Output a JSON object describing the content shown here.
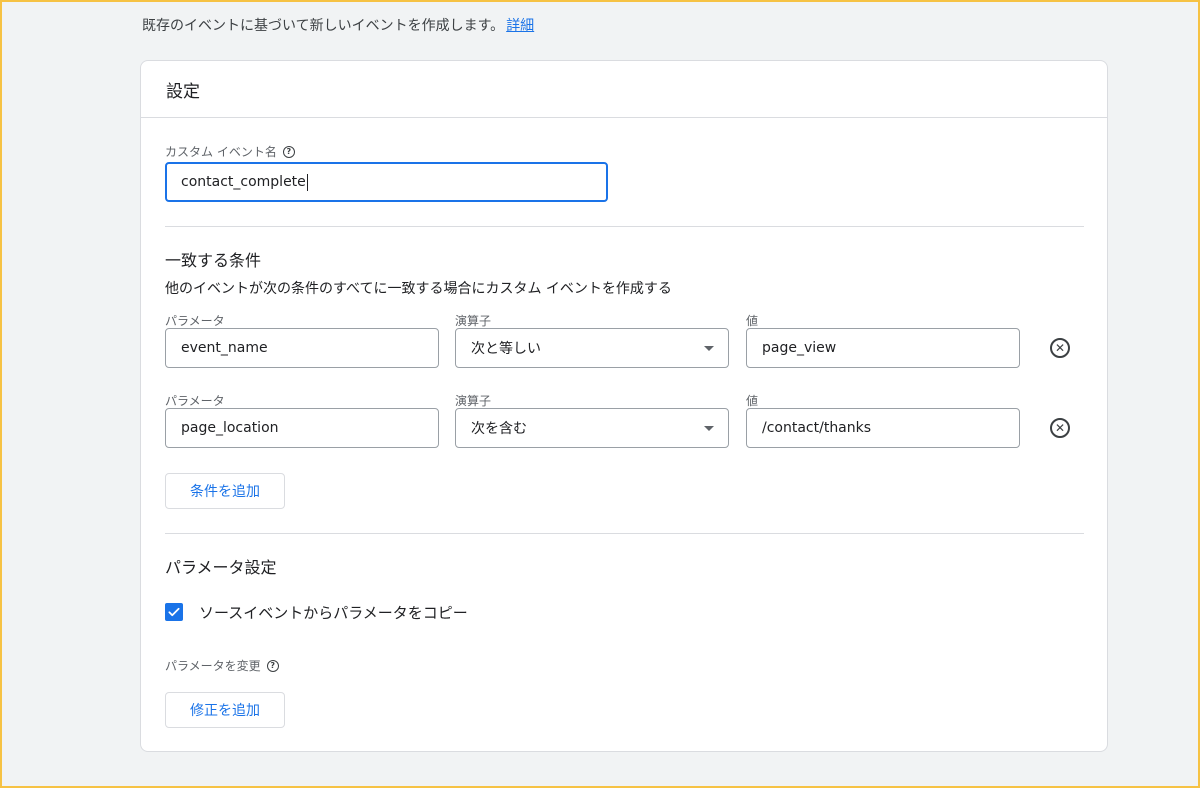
{
  "intro": {
    "text": "既存のイベントに基づいて新しいイベントを作成します。",
    "link": "詳細"
  },
  "card": {
    "title": "設定",
    "custom_event": {
      "label": "カスタム イベント名",
      "value": "contact_complete"
    },
    "conditions": {
      "title": "一致する条件",
      "description": "他のイベントが次の条件のすべてに一致する場合にカスタム イベントを作成する",
      "rows": [
        {
          "parameter_label": "パラメータ",
          "parameter_value": "event_name",
          "operator_label": "演算子",
          "operator_value": "次と等しい",
          "value_label": "値",
          "value_value": "page_view"
        },
        {
          "parameter_label": "パラメータ",
          "parameter_value": "page_location",
          "operator_label": "演算子",
          "operator_value": "次を含む",
          "value_label": "値",
          "value_value": "/contact/thanks"
        }
      ],
      "add_button": "条件を追加"
    },
    "parameters": {
      "title": "パラメータ設定",
      "copy_checkbox_label": "ソースイベントからパラメータをコピー",
      "copy_checked": true,
      "modify_label": "パラメータを変更",
      "add_modification_button": "修正を追加"
    }
  },
  "colors": {
    "accent": "#1a73e8",
    "border": "#dadce0",
    "background": "#f1f3f4",
    "frame": "#f6c244"
  },
  "icons": {
    "help": "help-circle-icon",
    "remove": "remove-circle-icon",
    "dropdown": "dropdown-arrow-icon",
    "check": "check-icon"
  }
}
